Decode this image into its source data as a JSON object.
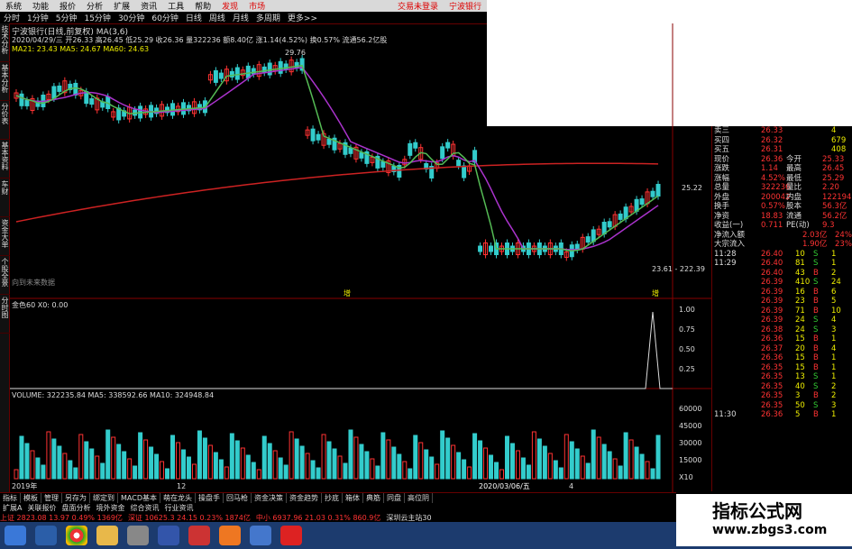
{
  "menu": [
    "系统",
    "功能",
    "报价",
    "分析",
    "扩展",
    "资讯",
    "工具",
    "帮助"
  ],
  "menu_right": [
    "交易未登录",
    "宁波银行"
  ],
  "menu_mid": [
    "发现",
    "市场"
  ],
  "periods": [
    "分时",
    "1分钟",
    "5分钟",
    "15分钟",
    "30分钟",
    "60分钟",
    "日线",
    "周线",
    "月线",
    "多周期",
    "更多>>"
  ],
  "vtabs": [
    "技术分析",
    "基本分析",
    "分价表",
    "基本资料",
    "车财",
    "资金大单",
    "个股全景",
    "分时图"
  ],
  "stock_title": "宁波银行(日线,前复权)",
  "ma_header": "MA(3,6)",
  "info_line": "2020/04/29/三 开26.33 高26.45 低25.29 收26.36 量322236 额8.40亿 涨1.14(4.52%) 换0.57% 流通56.2亿股",
  "ma_line": "MA21: 23.43  MA5: 24.67  MA60: 24.63",
  "price_high_label": "29.76",
  "price_low_label": "23.61 - 2",
  "right_axis_top": "25.22",
  "right_axis_low": "22.39",
  "no_future": "向到未来数据",
  "marker1": "增",
  "marker2": "增",
  "indicator_label": "金色60  X0: 0.00",
  "indicator_ticks": [
    "1.00",
    "0.75",
    "0.50",
    "0.25"
  ],
  "volume_label": "VOLUME: 322235.84  MA5: 338592.66  MA10: 324948.84",
  "volume_ticks": [
    "60000",
    "45000",
    "30000",
    "15000",
    "X10"
  ],
  "x_axis_dates": [
    "2019年",
    "12",
    "2020/03/06/五",
    "4"
  ],
  "order_book": [
    {
      "label": "卖三",
      "price": "26.33",
      "vol": "4"
    },
    {
      "label": "买四",
      "price": "26.32",
      "vol": "679"
    },
    {
      "label": "买五",
      "price": "26.31",
      "vol": "408"
    }
  ],
  "quote": [
    {
      "l": "现价",
      "v": "26.36",
      "l2": "今开",
      "v2": "25.33"
    },
    {
      "l": "涨跌",
      "v": "1.14",
      "l2": "最高",
      "v2": "26.45"
    },
    {
      "l": "涨幅",
      "v": "4.52%",
      "l2": "最低",
      "v2": "25.29"
    },
    {
      "l": "总量",
      "v": "322236",
      "l2": "量比",
      "v2": "2.20"
    },
    {
      "l": "外盘",
      "v": "200042",
      "l2": "内盘",
      "v2": "122194"
    },
    {
      "l": "换手",
      "v": "0.57%",
      "l2": "股本",
      "v2": "56.3亿"
    },
    {
      "l": "净资",
      "v": "18.83",
      "l2": "流通",
      "v2": "56.2亿"
    },
    {
      "l": "收益(一)",
      "v": "0.711",
      "l2": "PE(动)",
      "v2": "9.3"
    }
  ],
  "fund_flow": [
    {
      "label": "净流入额",
      "value": "2.03亿",
      "pct": "24%"
    },
    {
      "label": "大宗流入",
      "value": "1.90亿",
      "pct": "23%"
    }
  ],
  "ticks": [
    {
      "t": "11:28",
      "p": "26.40",
      "v": "10",
      "d": "S",
      "n": "1"
    },
    {
      "t": "11:29",
      "p": "26.40",
      "v": "81",
      "d": "S",
      "n": "1"
    },
    {
      "t": "",
      "p": "26.40",
      "v": "43",
      "d": "B",
      "n": "2"
    },
    {
      "t": "",
      "p": "26.39",
      "v": "410",
      "d": "S",
      "n": "24"
    },
    {
      "t": "",
      "p": "26.39",
      "v": "16",
      "d": "B",
      "n": "6"
    },
    {
      "t": "",
      "p": "26.39",
      "v": "23",
      "d": "B",
      "n": "5"
    },
    {
      "t": "",
      "p": "26.39",
      "v": "71",
      "d": "B",
      "n": "10"
    },
    {
      "t": "",
      "p": "26.39",
      "v": "24",
      "d": "S",
      "n": "4"
    },
    {
      "t": "",
      "p": "26.38",
      "v": "24",
      "d": "S",
      "n": "3"
    },
    {
      "t": "",
      "p": "26.36",
      "v": "15",
      "d": "B",
      "n": "1"
    },
    {
      "t": "",
      "p": "26.37",
      "v": "20",
      "d": "B",
      "n": "4"
    },
    {
      "t": "",
      "p": "26.36",
      "v": "15",
      "d": "B",
      "n": "1"
    },
    {
      "t": "",
      "p": "26.35",
      "v": "15",
      "d": "B",
      "n": "1"
    },
    {
      "t": "",
      "p": "26.35",
      "v": "13",
      "d": "S",
      "n": "1"
    },
    {
      "t": "",
      "p": "26.35",
      "v": "40",
      "d": "S",
      "n": "2"
    },
    {
      "t": "",
      "p": "26.35",
      "v": "3",
      "d": "B",
      "n": "2"
    },
    {
      "t": "",
      "p": "26.35",
      "v": "50",
      "d": "S",
      "n": "3"
    },
    {
      "t": "11:30",
      "p": "26.36",
      "v": "5",
      "d": "B",
      "n": "1"
    }
  ],
  "bottom_tabs": [
    "指标",
    "模板",
    "管理",
    "另存为",
    "绑定到",
    "MACD基本",
    "萌在龙头",
    "操盘手",
    "回马枪",
    "资金决策",
    "资金趋势",
    "抄底",
    "箱体",
    "典筋",
    "同盘",
    "高位阴"
  ],
  "bottom_tabs2": [
    "扩展A",
    "关联报价",
    "盘面分析",
    "境外资金",
    "综合资讯",
    "行业资讯"
  ],
  "status_bar": [
    "上证 2823.08 13.97 0.49% 1369亿",
    "深证 10625.3 24.15 0.23% 1874亿",
    "中小 6937.96 21.03 0.31% 860.9亿",
    "深圳云主站30"
  ],
  "right_tab_labels": [
    "日线",
    "图文F10"
  ],
  "watermark_title": "指标公式网",
  "watermark_url": "www.zbgs3.com",
  "colors": {
    "up": "#ff3333",
    "down": "#33cccc",
    "ma_slow": "#cc2222",
    "ma_mid": "#aa33cc",
    "ma_fast": "#55bb55"
  }
}
